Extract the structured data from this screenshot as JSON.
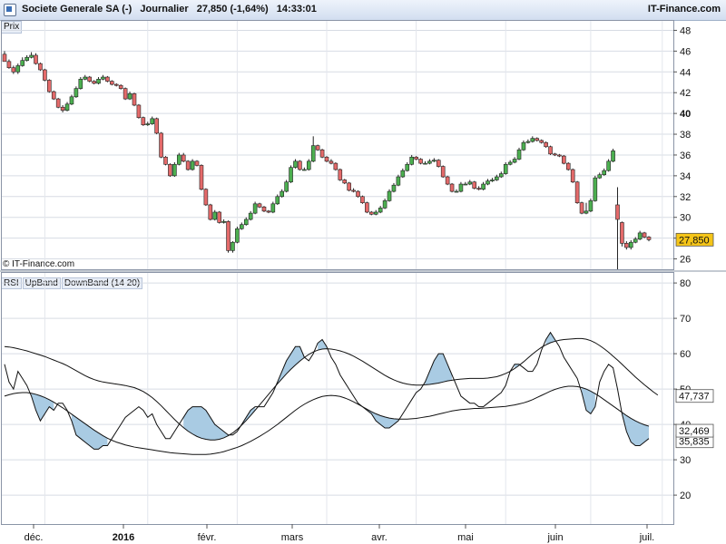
{
  "header": {
    "title": "Societe Generale SA (-)   Journalier   27,850 (-1,64%)   14:33:01",
    "brand": "IT-Finance.com"
  },
  "price_panel": {
    "label": "Prix",
    "copyright": "© IT-Finance.com"
  },
  "rsi_panel": {
    "labels": [
      "RSI",
      "UpBand",
      "DownBand (14 20)"
    ]
  },
  "x_labels": [
    "déc.",
    "2016",
    "févr.",
    "mars",
    "avr.",
    "mai",
    "juin",
    "juil."
  ],
  "colors": {
    "up": "#4caf50",
    "down": "#e46a6a",
    "fill": "#a9cbe3",
    "last_badge": "#f5c518"
  },
  "chart_data": [
    {
      "type": "candlestick",
      "title": "Societe Generale SA (-)",
      "ylabel": "Prix",
      "ylim": [
        25,
        49
      ],
      "y_ticks": [
        26,
        28,
        30,
        32,
        34,
        36,
        38,
        40,
        42,
        44,
        46,
        48
      ],
      "last_value": "27,850",
      "close": [
        45.0,
        44.4,
        44.0,
        44.6,
        45.1,
        45.4,
        45.6,
        44.8,
        44.2,
        43.2,
        42.1,
        41.4,
        40.6,
        40.3,
        40.9,
        41.6,
        42.4,
        43.3,
        43.5,
        43.1,
        42.9,
        43.3,
        43.5,
        43.1,
        42.8,
        42.7,
        42.4,
        41.4,
        41.9,
        40.8,
        39.6,
        38.9,
        39.0,
        39.5,
        38.1,
        35.8,
        35.1,
        34.0,
        35.1,
        36.0,
        35.4,
        34.6,
        35.4,
        35.0,
        32.7,
        31.2,
        29.8,
        30.5,
        29.5,
        29.6,
        26.8,
        27.6,
        28.9,
        29.3,
        29.8,
        30.4,
        31.3,
        31.0,
        30.6,
        30.5,
        31.3,
        32.0,
        32.5,
        33.4,
        34.8,
        35.4,
        34.6,
        34.6,
        35.4,
        36.9,
        36.5,
        35.8,
        35.4,
        35.2,
        34.6,
        33.6,
        33.3,
        32.6,
        32.5,
        32.0,
        31.4,
        30.5,
        30.3,
        30.5,
        30.9,
        31.6,
        32.5,
        33.1,
        33.9,
        34.5,
        35.1,
        35.8,
        35.6,
        35.2,
        35.2,
        35.4,
        35.5,
        34.9,
        33.9,
        33.2,
        32.5,
        32.5,
        33.2,
        33.2,
        33.4,
        32.8,
        32.7,
        33.2,
        33.5,
        33.6,
        33.9,
        34.2,
        35.1,
        35.3,
        35.6,
        36.5,
        37.2,
        37.3,
        37.6,
        37.4,
        37.2,
        36.8,
        36.1,
        36.0,
        35.9,
        35.2,
        34.6,
        33.4,
        31.4,
        30.4,
        30.6,
        31.6,
        33.8,
        34.1,
        34.5,
        35.4,
        36.4,
        29.8,
        27.5,
        27.1,
        27.6,
        27.9,
        28.5,
        28.1,
        27.85
      ],
      "open": [
        45.7,
        45.0,
        44.4,
        44.0,
        44.6,
        45.1,
        45.4,
        45.6,
        44.8,
        44.2,
        43.2,
        42.1,
        41.4,
        40.6,
        40.3,
        40.9,
        41.6,
        42.4,
        43.3,
        43.5,
        43.1,
        42.9,
        43.3,
        43.5,
        43.1,
        42.8,
        42.7,
        42.4,
        41.4,
        41.9,
        40.8,
        39.6,
        38.9,
        39.0,
        39.5,
        38.1,
        35.8,
        35.1,
        34.0,
        35.1,
        36.0,
        35.4,
        34.6,
        35.4,
        35.0,
        32.7,
        31.2,
        29.8,
        30.5,
        29.5,
        29.6,
        26.8,
        27.6,
        28.9,
        29.3,
        29.8,
        30.4,
        31.3,
        31.0,
        30.6,
        30.5,
        31.3,
        32.0,
        32.5,
        33.4,
        34.8,
        35.4,
        34.6,
        34.6,
        35.4,
        36.9,
        36.5,
        35.8,
        35.4,
        35.2,
        34.6,
        33.6,
        33.3,
        32.6,
        32.5,
        32.0,
        31.4,
        30.5,
        30.3,
        30.5,
        30.9,
        31.6,
        32.5,
        33.1,
        33.9,
        34.5,
        35.1,
        35.8,
        35.6,
        35.2,
        35.2,
        35.4,
        35.5,
        34.9,
        33.9,
        33.2,
        32.5,
        32.5,
        33.2,
        33.2,
        33.4,
        32.8,
        32.7,
        33.2,
        33.5,
        33.6,
        33.9,
        34.2,
        35.1,
        35.3,
        35.6,
        36.5,
        37.2,
        37.3,
        37.6,
        37.4,
        37.2,
        36.8,
        36.1,
        36.0,
        35.9,
        35.2,
        34.6,
        33.4,
        31.4,
        30.4,
        30.6,
        31.6,
        33.8,
        34.1,
        34.5,
        35.4,
        31.2,
        29.5,
        27.5,
        27.1,
        27.6,
        27.9,
        28.5,
        28.1
      ],
      "high": [
        46.0,
        45.2,
        44.6,
        44.8,
        45.4,
        45.6,
        45.9,
        45.8,
        44.9,
        44.3,
        43.3,
        42.2,
        41.5,
        40.8,
        41.1,
        41.8,
        42.6,
        43.5,
        43.7,
        43.6,
        43.2,
        43.5,
        43.7,
        43.6,
        43.2,
        42.9,
        42.8,
        42.5,
        42.1,
        42.0,
        40.9,
        39.7,
        39.2,
        39.7,
        39.6,
        38.2,
        35.9,
        35.2,
        35.3,
        36.2,
        36.2,
        35.5,
        35.6,
        35.5,
        35.1,
        32.8,
        31.3,
        30.7,
        30.6,
        29.8,
        29.7,
        27.7,
        29.1,
        29.5,
        30.0,
        30.6,
        31.5,
        31.4,
        31.1,
        30.7,
        31.5,
        32.2,
        32.7,
        33.6,
        35.0,
        35.6,
        35.5,
        34.8,
        35.6,
        37.8,
        37.0,
        36.6,
        35.9,
        35.6,
        35.3,
        34.7,
        33.7,
        33.4,
        32.8,
        32.6,
        32.1,
        31.5,
        30.6,
        30.7,
        31.1,
        31.8,
        32.7,
        33.3,
        34.1,
        34.7,
        35.3,
        36.0,
        35.9,
        35.7,
        35.4,
        35.6,
        35.7,
        35.6,
        35.0,
        34.0,
        33.3,
        32.7,
        33.4,
        33.4,
        33.6,
        33.5,
        33.0,
        33.4,
        33.7,
        33.8,
        34.1,
        34.4,
        35.3,
        35.5,
        35.8,
        36.7,
        37.4,
        37.5,
        37.8,
        37.7,
        37.5,
        37.3,
        36.9,
        36.2,
        36.1,
        36.0,
        35.3,
        34.7,
        33.5,
        31.5,
        31.4,
        31.8,
        34.0,
        34.3,
        34.7,
        35.6,
        36.6,
        32.9,
        29.6,
        27.7,
        27.8,
        28.1,
        28.7,
        28.6,
        28.2
      ],
      "low": [
        45.0,
        44.3,
        43.8,
        43.8,
        44.5,
        45.0,
        45.3,
        44.7,
        44.1,
        43.1,
        42.0,
        41.3,
        40.5,
        40.1,
        40.2,
        40.8,
        41.5,
        42.3,
        43.2,
        43.0,
        42.8,
        42.8,
        43.2,
        43.0,
        42.7,
        42.6,
        42.3,
        41.3,
        41.3,
        40.7,
        39.5,
        38.8,
        38.8,
        38.9,
        38.0,
        35.7,
        35.0,
        33.9,
        33.9,
        35.0,
        35.3,
        34.5,
        34.5,
        34.9,
        32.6,
        31.1,
        29.7,
        29.7,
        29.4,
        29.4,
        26.6,
        26.6,
        27.5,
        28.8,
        29.2,
        29.7,
        30.3,
        30.9,
        30.5,
        30.4,
        30.4,
        31.2,
        31.9,
        32.4,
        33.3,
        34.7,
        34.5,
        34.5,
        34.5,
        35.3,
        36.4,
        35.7,
        35.3,
        35.1,
        34.5,
        33.5,
        33.2,
        32.5,
        32.4,
        31.9,
        31.3,
        30.4,
        30.2,
        30.2,
        30.4,
        30.8,
        31.5,
        32.4,
        33.0,
        33.8,
        34.4,
        35.0,
        35.5,
        35.1,
        35.1,
        35.1,
        35.3,
        34.8,
        33.8,
        33.1,
        32.4,
        32.4,
        32.4,
        33.1,
        33.1,
        32.7,
        32.6,
        32.6,
        33.1,
        33.4,
        33.5,
        33.8,
        34.1,
        35.0,
        35.2,
        35.5,
        36.4,
        37.1,
        37.2,
        37.3,
        37.1,
        36.7,
        36.0,
        35.9,
        35.8,
        35.1,
        34.5,
        33.3,
        31.3,
        30.3,
        30.3,
        30.5,
        31.5,
        33.7,
        34.0,
        34.4,
        35.3,
        25.0,
        27.2,
        26.9,
        26.9,
        27.5,
        27.8,
        28.0,
        27.7
      ]
    },
    {
      "type": "line",
      "title": "RSI UpBand DownBand (14 20)",
      "ylim": [
        11,
        80
      ],
      "y_ticks": [
        20,
        30,
        40,
        50,
        60,
        70,
        80
      ],
      "series": [
        {
          "name": "RSI",
          "values": [
            57,
            52,
            50,
            55,
            53,
            51,
            48,
            44,
            41,
            43,
            45,
            44,
            46,
            46,
            44,
            41,
            37,
            36,
            35,
            34,
            33,
            33,
            34,
            34,
            36,
            38,
            40,
            42,
            43,
            44,
            45,
            44,
            42,
            43,
            40,
            38,
            36,
            36,
            38,
            40,
            42,
            44,
            45,
            45,
            45,
            44,
            42,
            40,
            39,
            38,
            37,
            37,
            38,
            40,
            42,
            44,
            45,
            45,
            45,
            47,
            49,
            52,
            55,
            58,
            60,
            62,
            62,
            59,
            58,
            60,
            63,
            64,
            62,
            59,
            57,
            54,
            52,
            50,
            48,
            46,
            45,
            44,
            43,
            41,
            40,
            39,
            39,
            40,
            41,
            43,
            45,
            47,
            49,
            50,
            52,
            55,
            58,
            60,
            60,
            57,
            54,
            51,
            48,
            47,
            46,
            46,
            45,
            45,
            46,
            47,
            48,
            49,
            51,
            55,
            57,
            57,
            56,
            55,
            55,
            57,
            61,
            64,
            66,
            64,
            62,
            59,
            57,
            55,
            53,
            49,
            44,
            43,
            45,
            52,
            55,
            57,
            56,
            50,
            43,
            38,
            35,
            34,
            34,
            35,
            36
          ]
        },
        {
          "name": "UpBand",
          "values": [
            62.0,
            61.9,
            61.7,
            61.4,
            61.1,
            60.8,
            60.4,
            60.0,
            59.6,
            59.2,
            58.7,
            58.2,
            57.7,
            57.2,
            56.6,
            55.9,
            55.2,
            54.5,
            53.8,
            53.2,
            52.7,
            52.3,
            52.0,
            51.8,
            51.6,
            51.4,
            51.2,
            51.0,
            50.7,
            50.4,
            49.9,
            49.3,
            48.5,
            47.6,
            46.5,
            45.3,
            44.0,
            42.7,
            41.4,
            40.2,
            39.1,
            38.1,
            37.3,
            36.6,
            36.1,
            35.8,
            35.6,
            35.6,
            35.8,
            36.2,
            36.8,
            37.6,
            38.6,
            39.8,
            41.1,
            42.5,
            44.0,
            45.5,
            47.0,
            48.5,
            50.0,
            51.5,
            52.9,
            54.3,
            55.6,
            56.8,
            57.9,
            58.9,
            59.8,
            60.5,
            61.0,
            61.3,
            61.4,
            61.3,
            61.1,
            60.8,
            60.4,
            59.9,
            59.3,
            58.6,
            57.9,
            57.1,
            56.3,
            55.5,
            54.7,
            53.9,
            53.2,
            52.6,
            52.1,
            51.7,
            51.4,
            51.2,
            51.1,
            51.1,
            51.2,
            51.3,
            51.5,
            51.7,
            52.0,
            52.3,
            52.5,
            52.7,
            52.8,
            52.9,
            53.0,
            53.0,
            53.0,
            53.0,
            53.1,
            53.3,
            53.5,
            53.9,
            54.4,
            55.0,
            55.8,
            56.7,
            57.7,
            58.8,
            59.9,
            60.9,
            61.8,
            62.5,
            63.1,
            63.5,
            63.8,
            64.0,
            64.1,
            64.2,
            64.3,
            64.3,
            64.1,
            63.7,
            63.1,
            62.3,
            61.4,
            60.4,
            59.3,
            58.2,
            57.0,
            55.8,
            54.6,
            53.4,
            52.3,
            51.2,
            50.2,
            49.2,
            48.3
          ]
        },
        {
          "name": "DownBand",
          "values": [
            48.0,
            48.4,
            48.7,
            48.9,
            49.0,
            49.0,
            48.8,
            48.5,
            48.1,
            47.6,
            47.0,
            46.3,
            45.5,
            44.7,
            43.8,
            42.9,
            42.0,
            41.1,
            40.2,
            39.3,
            38.4,
            37.6,
            36.8,
            36.1,
            35.5,
            35.0,
            34.6,
            34.2,
            33.9,
            33.6,
            33.4,
            33.2,
            33.0,
            32.8,
            32.6,
            32.4,
            32.2,
            32.0,
            31.9,
            31.8,
            31.7,
            31.6,
            31.5,
            31.5,
            31.5,
            31.5,
            31.6,
            31.8,
            32.0,
            32.3,
            32.7,
            33.1,
            33.5,
            34.0,
            34.6,
            35.2,
            35.9,
            36.6,
            37.4,
            38.2,
            39.1,
            40.0,
            41.0,
            42.0,
            43.0,
            44.0,
            44.9,
            45.7,
            46.4,
            47.0,
            47.5,
            47.9,
            48.1,
            48.2,
            48.1,
            47.9,
            47.5,
            47.0,
            46.4,
            45.7,
            45.0,
            44.3,
            43.6,
            43.0,
            42.5,
            42.1,
            41.8,
            41.6,
            41.5,
            41.5,
            41.5,
            41.6,
            41.7,
            41.9,
            42.1,
            42.3,
            42.6,
            42.9,
            43.2,
            43.5,
            43.8,
            44.0,
            44.2,
            44.3,
            44.4,
            44.5,
            44.5,
            44.6,
            44.7,
            44.8,
            44.9,
            45.0,
            45.1,
            45.3,
            45.5,
            45.8,
            46.1,
            46.5,
            47.0,
            47.6,
            48.2,
            48.8,
            49.4,
            49.9,
            50.3,
            50.6,
            50.8,
            50.8,
            50.7,
            50.4,
            50.0,
            49.4,
            48.7,
            47.9,
            47.0,
            46.1,
            45.2,
            44.3,
            43.4,
            42.5,
            41.7,
            41.0,
            40.4,
            39.9,
            39.5
          ]
        }
      ],
      "last_values": {
        "UpBand": "47,737",
        "RSI": "35,835",
        "DownBand": "32,469"
      }
    }
  ]
}
